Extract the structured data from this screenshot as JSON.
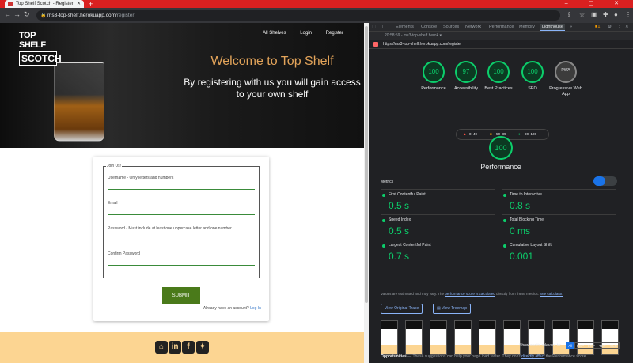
{
  "browser": {
    "tab_title": "Top Shelf Scotch - Register",
    "new_tab": "+",
    "window_controls": "–  ▢  ✕",
    "url_host": "ms3-top-shelf.herokuapp.com",
    "url_path": "/register"
  },
  "site": {
    "logo_line1": "TOP SHELF",
    "logo_line2": "SCOTCH",
    "nav": [
      "All Shelves",
      "Login",
      "Register"
    ],
    "welcome": "Welcome to Top Shelf",
    "subtitle": "By registering with us you will gain access to your own shelf",
    "form": {
      "legend": "Join Us!",
      "fields": [
        "Username - Only letters and numbers",
        "Email",
        "Password - Must include at least one uppercase letter and one number.",
        "Confirm Password"
      ],
      "submit": "SUBMIT",
      "already": "Already have an account?",
      "login_link": "Log In"
    },
    "social": [
      "github-icon",
      "linkedin-icon",
      "facebook-icon",
      "twitter-icon"
    ],
    "social_glyphs": [
      "⌂",
      "in",
      "f",
      "✦"
    ]
  },
  "devtools": {
    "tabs": [
      "Elements",
      "Console",
      "Sources",
      "Network",
      "Performance",
      "Memory",
      "Lighthouse",
      "»"
    ],
    "active_tab": "Lighthouse",
    "session": "20:58:59 - ms3-top-shelf.herok ▾",
    "report_url": "https://ms3-top-shelf.herokuapp.com/register",
    "scores": [
      {
        "label": "Performance",
        "value": "100"
      },
      {
        "label": "Accessibility",
        "value": "97"
      },
      {
        "label": "Best Practices",
        "value": "100"
      },
      {
        "label": "SEO",
        "value": "100"
      },
      {
        "label": "Progressive Web App",
        "value": "PWA"
      }
    ],
    "legend": [
      "0–49",
      "50–89",
      "90–100"
    ],
    "perf_score": "100",
    "perf_title": "Performance",
    "metrics_heading": "Metrics",
    "metrics": [
      {
        "name": "First Contentful Paint",
        "value": "0.5 s"
      },
      {
        "name": "Time to Interactive",
        "value": "0.8 s"
      },
      {
        "name": "Speed Index",
        "value": "0.5 s"
      },
      {
        "name": "Total Blocking Time",
        "value": "0 ms"
      },
      {
        "name": "Largest Contentful Paint",
        "value": "0.7 s"
      },
      {
        "name": "Cumulative Layout Shift",
        "value": "0.001"
      }
    ],
    "note_prefix": "Values are estimated and may vary. The",
    "note_link1": "performance score is calculated",
    "note_mid": "directly from these metrics.",
    "note_link2": "See calculator.",
    "btn_trace": "View Original Trace",
    "btn_treemap": "View Treemap",
    "audits_label": "Show audits relevant to:",
    "audit_chips": [
      "All",
      "FCP",
      "LCP",
      "TBT",
      "CLS"
    ],
    "opps_label": "Opportunities",
    "opps_text": " — These suggestions can help your page load faster. They don't",
    "opps_link": "directly affect",
    "opps_tail": "the Performance score."
  },
  "colors": {
    "accent": "#0cce6b",
    "brand_gold": "#e3a45a",
    "footer": "#fcd592",
    "submit": "#4a7a1a"
  }
}
